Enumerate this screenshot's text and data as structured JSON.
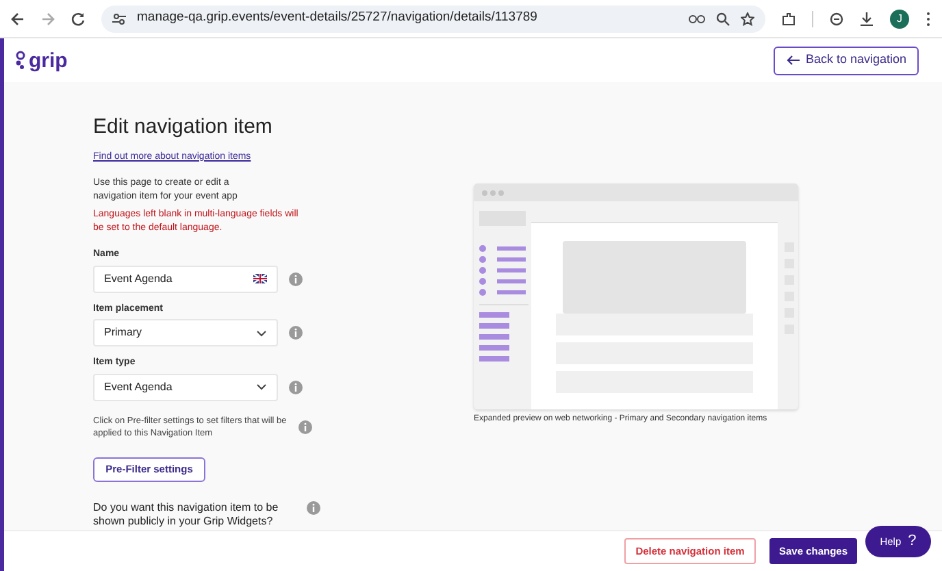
{
  "browser": {
    "url": "manage-qa.grip.events/event-details/25727/navigation/details/113789",
    "profile_initial": "J"
  },
  "header": {
    "logo": "grip",
    "back_button": "Back to navigation"
  },
  "form": {
    "title": "Edit navigation item",
    "help_link": "Find out more about navigation items",
    "intro": "Use this page to create or edit a navigation item for your event app",
    "warning": "Languages left blank in multi-language fields will be set to the default language.",
    "fields": [
      {
        "kind": "text",
        "label": "Name",
        "value": "Event Agenda"
      },
      {
        "kind": "select",
        "label": "Item placement",
        "value": "Primary"
      },
      {
        "kind": "select",
        "label": "Item type",
        "value": "Event Agenda"
      }
    ],
    "prefilter_note": "Click on Pre-filter settings to set filters that will be applied to this Navigation Item",
    "prefilter_button": "Pre-Filter settings",
    "public_question": "Do you want this navigation item to be shown publicly in your Grip Widgets?"
  },
  "preview": {
    "caption": "Expanded preview on web networking - Primary and Secondary navigation items"
  },
  "footer": {
    "buttons": [
      {
        "kind": "danger",
        "label": "Delete navigation item"
      },
      {
        "kind": "primary",
        "label": "Save changes"
      }
    ]
  },
  "help": {
    "label": "Help",
    "icon": "?"
  }
}
